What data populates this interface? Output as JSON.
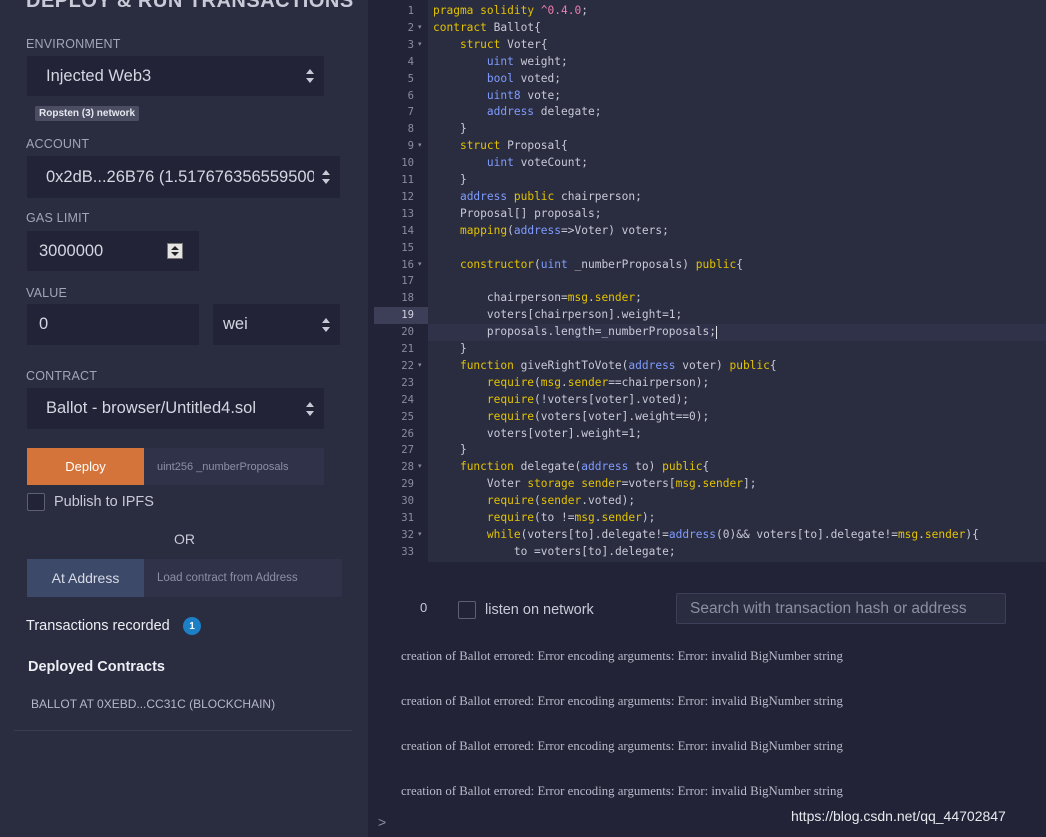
{
  "left_panel": {
    "title": "DEPLOY & RUN TRANSACTIONS",
    "environment": {
      "label": "ENVIRONMENT",
      "value": "Injected Web3",
      "network_badge": "Ropsten (3) network"
    },
    "account": {
      "label": "ACCOUNT",
      "value": "0x2dB...26B76 (1.517676356559500"
    },
    "gas_limit": {
      "label": "GAS LIMIT",
      "value": "3000000"
    },
    "value": {
      "label": "VALUE",
      "amount": "0",
      "unit": "wei"
    },
    "contract": {
      "label": "CONTRACT",
      "value": "Ballot - browser/Untitled4.sol"
    },
    "deploy": {
      "button": "Deploy",
      "arg_placeholder": "uint256 _numberProposals"
    },
    "publish_label": "Publish to IPFS",
    "or_text": "OR",
    "at_address": {
      "button": "At Address",
      "placeholder": "Load contract from Address"
    },
    "transactions_recorded": {
      "label": "Transactions recorded",
      "count": "1"
    },
    "deployed_contracts": {
      "title": "Deployed Contracts",
      "items": [
        "BALLOT AT 0XEBD...CC31C (BLOCKCHAIN)"
      ]
    }
  },
  "editor": {
    "active_line": 19,
    "highlighted_line": 20,
    "folded_lines": [
      2,
      3,
      9,
      16,
      22,
      28,
      32
    ],
    "lines": [
      "pragma solidity ^0.4.0;",
      "contract Ballot{",
      "    struct Voter{",
      "        uint weight;",
      "        bool voted;",
      "        uint8 vote;",
      "        address delegate;",
      "    }",
      "    struct Proposal{",
      "        uint voteCount;",
      "    }",
      "    address public chairperson;",
      "    Proposal[] proposals;",
      "    mapping(address=>Voter) voters;",
      "",
      "    constructor(uint _numberProposals) public{",
      "",
      "        chairperson=msg.sender;",
      "        voters[chairperson].weight=1;",
      "        proposals.length=_numberProposals;",
      "    }",
      "    function giveRightToVote(address voter) public{",
      "        require(msg.sender==chairperson);",
      "        require(!voters[voter].voted);",
      "        require(voters[voter].weight==0);",
      "        voters[voter].weight=1;",
      "    }",
      "    function delegate(address to) public{",
      "        Voter storage sender=voters[msg.sender];",
      "        require(sender.voted);",
      "        require(to !=msg.sender);",
      "        while(voters[to].delegate!=address(0)&& voters[to].delegate!=msg.sender){",
      "            to =voters[to].delegate;"
    ]
  },
  "terminal": {
    "pending_count": "0",
    "listen_label": "listen on network",
    "search_placeholder": "Search with transaction hash or address",
    "logs": [
      "creation of Ballot errored: Error encoding arguments: Error: invalid BigNumber string",
      "creation of Ballot errored: Error encoding arguments: Error: invalid BigNumber string",
      "creation of Ballot errored: Error encoding arguments: Error: invalid BigNumber string",
      "creation of Ballot errored: Error encoding arguments: Error: invalid BigNumber string"
    ],
    "prompt": ">",
    "watermark": "https://blog.csdn.net/qq_44702847"
  },
  "colors": {
    "panel_bg": "#2a2c3f",
    "input_bg": "#222336",
    "deploy_orange": "#d5743a",
    "at_address_blue": "#3c4968",
    "keyword_yellow": "#e3c300",
    "type_blue": "#7f9cff",
    "string_pink": "#ea7fb0",
    "badge_blue": "#1d7fc6"
  }
}
